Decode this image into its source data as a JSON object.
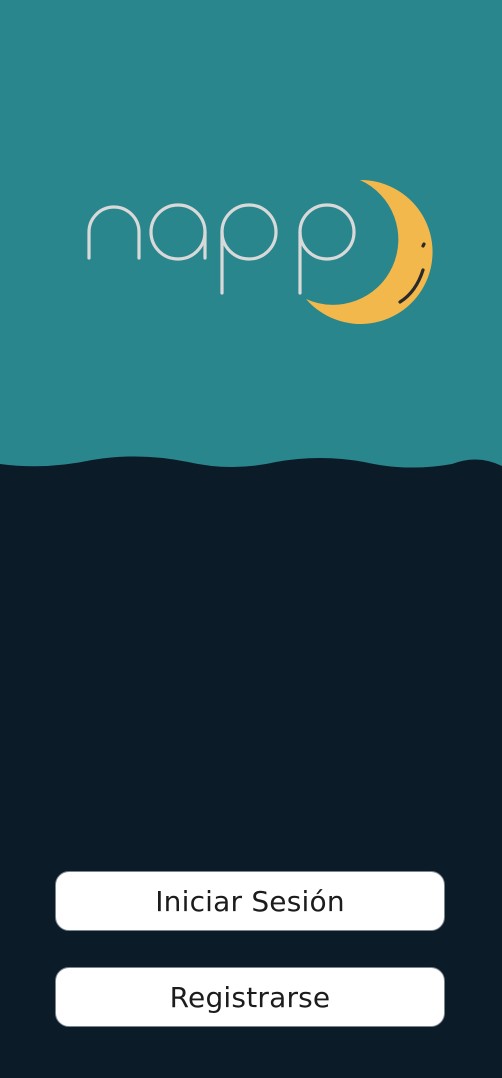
{
  "brand": {
    "name": "napp",
    "logo_icon": "smiling-moon-icon",
    "colors": {
      "header_bg": "#2a868d",
      "body_bg": "#0b1b28",
      "moon": "#f2b84b",
      "logo_text": "#d9d9d9"
    }
  },
  "actions": {
    "login_label": "Iniciar Sesión",
    "register_label": "Registrarse"
  }
}
